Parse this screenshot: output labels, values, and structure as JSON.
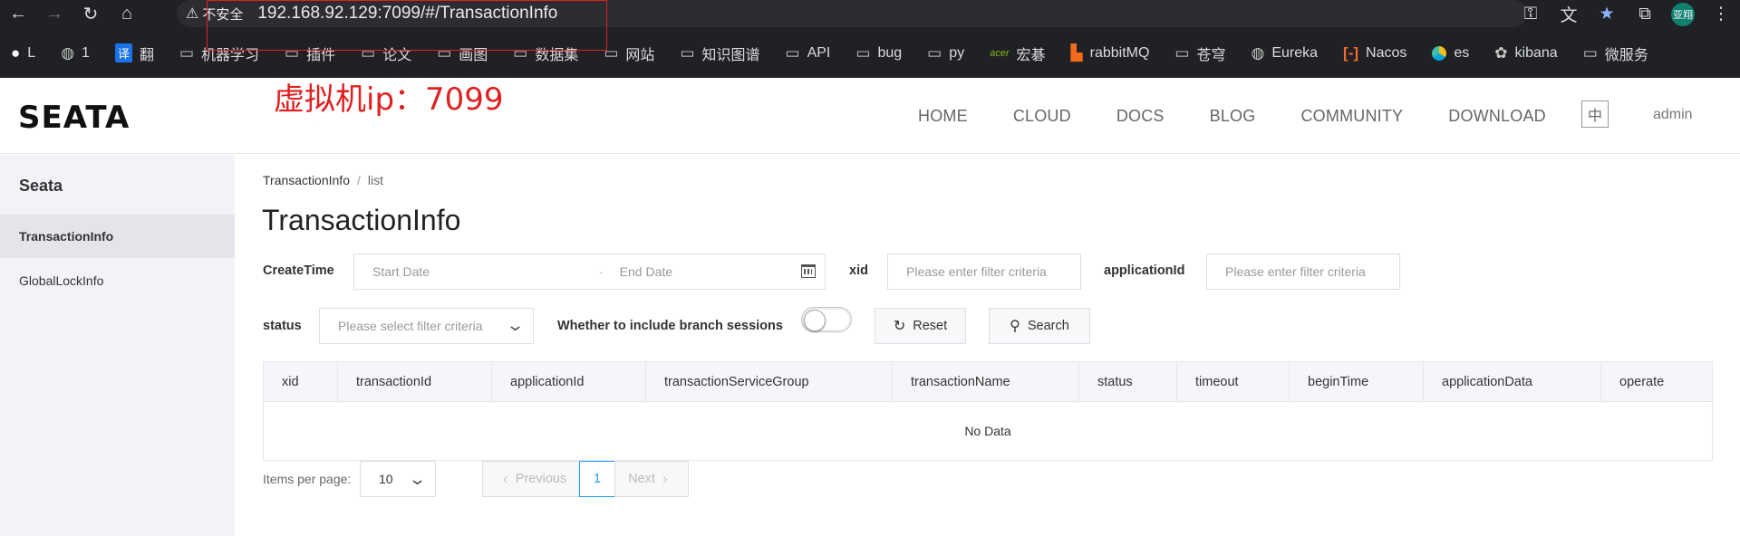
{
  "browser": {
    "security_label": "不安全",
    "url": "192.168.92.129:7099/#/TransactionInfo",
    "profile_label": "亚翔",
    "bookmarks": [
      {
        "icon": "github-icon",
        "label": "L"
      },
      {
        "icon": "globe-icon",
        "label": "1"
      },
      {
        "icon": "translate-icon",
        "label": "翻"
      },
      {
        "icon": "folder-icon",
        "label": "机器学习"
      },
      {
        "icon": "folder-icon",
        "label": "插件"
      },
      {
        "icon": "folder-icon",
        "label": "论文"
      },
      {
        "icon": "folder-icon",
        "label": "画图"
      },
      {
        "icon": "folder-icon",
        "label": "数据集"
      },
      {
        "icon": "folder-icon",
        "label": "网站"
      },
      {
        "icon": "folder-icon",
        "label": "知识图谱"
      },
      {
        "icon": "folder-icon",
        "label": "API"
      },
      {
        "icon": "folder-icon",
        "label": "bug"
      },
      {
        "icon": "folder-icon",
        "label": "py"
      },
      {
        "icon": "acer-icon",
        "label": "宏碁"
      },
      {
        "icon": "rabbitmq-icon",
        "label": "rabbitMQ"
      },
      {
        "icon": "folder-icon",
        "label": "苍穹"
      },
      {
        "icon": "globe-icon",
        "label": "Eureka"
      },
      {
        "icon": "nacos-icon",
        "label": "Nacos"
      },
      {
        "icon": "elastic-icon",
        "label": "es"
      },
      {
        "icon": "kibana-icon",
        "label": "kibana"
      },
      {
        "icon": "folder-icon",
        "label": "微服务"
      }
    ]
  },
  "annotation": "虚拟机ip：7099",
  "header": {
    "logo": "SEATA",
    "nav": [
      "HOME",
      "CLOUD",
      "DOCS",
      "BLOG",
      "COMMUNITY",
      "DOWNLOAD"
    ],
    "lang": "中",
    "user": "admin"
  },
  "sidebar": {
    "title": "Seata",
    "items": [
      {
        "label": "TransactionInfo",
        "active": true
      },
      {
        "label": "GlobalLockInfo",
        "active": false
      }
    ]
  },
  "main": {
    "breadcrumb": [
      "TransactionInfo",
      "list"
    ],
    "title": "TransactionInfo",
    "filters": {
      "create_time_label": "CreateTime",
      "start_placeholder": "Start Date",
      "end_placeholder": "End Date",
      "range_sep": "-",
      "xid_label": "xid",
      "xid_placeholder": "Please enter filter criteria",
      "app_label": "applicationId",
      "app_placeholder": "Please enter filter criteria",
      "status_label": "status",
      "status_placeholder": "Please select filter criteria",
      "branch_label": "Whether to include branch sessions",
      "branch_on": false,
      "reset": "Reset",
      "search": "Search"
    },
    "table": {
      "columns": [
        "xid",
        "transactionId",
        "applicationId",
        "transactionServiceGroup",
        "transactionName",
        "status",
        "timeout",
        "beginTime",
        "applicationData",
        "operate"
      ],
      "empty": "No Data"
    },
    "pagination": {
      "per_page_label": "Items per page:",
      "per_page": "10",
      "prev": "Previous",
      "current": "1",
      "next": "Next"
    }
  }
}
